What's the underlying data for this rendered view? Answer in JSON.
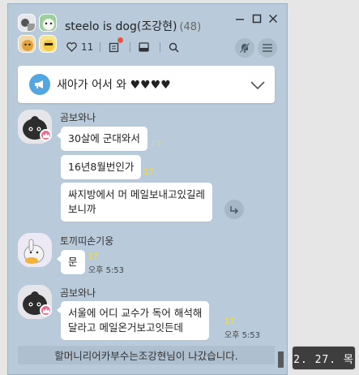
{
  "chat": {
    "title": "steelo is dog(조강현)",
    "member_count": "(48)",
    "likes": "11",
    "notice_text": "새아가 어서 와 ♥♥♥♥",
    "cutoff_text": " "
  },
  "messages": [
    {
      "sender": "곰보와나",
      "bubbles": [
        {
          "text": "30살에 군대와서",
          "unread": "17"
        },
        {
          "text": "16년8월번인가",
          "unread": "17"
        },
        {
          "text": "싸지방에서 머 메일보내고있길레\n보니까",
          "unread": ""
        }
      ]
    },
    {
      "sender": "토끼띠손기웅",
      "bubbles": [
        {
          "text": "문",
          "unread": "17",
          "time": "오후 5:53"
        }
      ]
    },
    {
      "sender": "곰보와나",
      "bubbles": [
        {
          "text": "서울에 어디 교수가 독어 해석해\n달라고 메일온거보고잇든데",
          "unread": "17",
          "time": "오후 5:53"
        }
      ]
    }
  ],
  "system_message": "할머니리어카부수는조강현님이 나갔습니다.",
  "date_tooltip": "2. 27. 목",
  "colors": {
    "chat_background": "#b9cbdb",
    "bubble": "#ffffff",
    "unread_count": "#eedc4a",
    "notice_icon": "#53a7e0",
    "owner_badge": "#ef6b8f"
  },
  "icons": {
    "likes": "heart-icon",
    "notes": "note-icon",
    "album": "album-icon",
    "search": "search-icon",
    "mute": "bell-off-icon",
    "menu": "menu-icon",
    "notice": "megaphone-icon",
    "notice_toggle": "chevron-down-icon",
    "share": "share-icon",
    "owner": "crown-icon"
  }
}
